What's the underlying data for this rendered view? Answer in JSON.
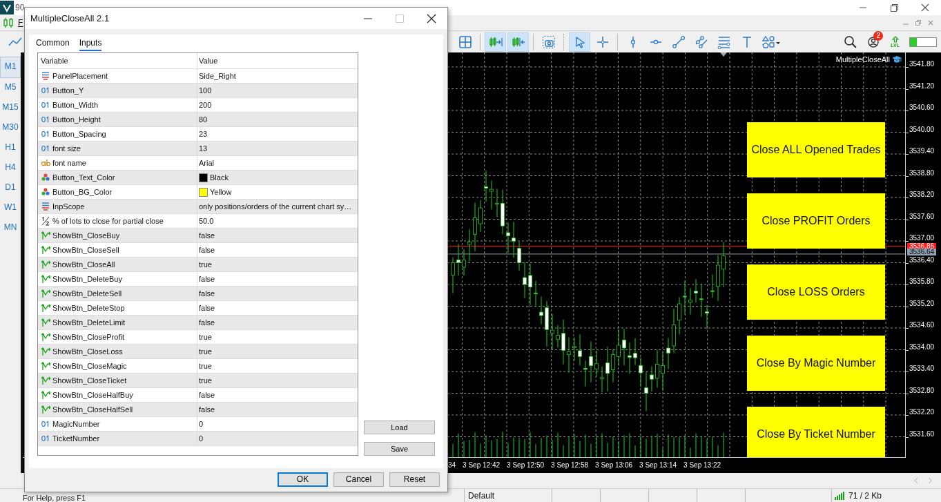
{
  "app": {
    "title": "90",
    "menu": [
      "F"
    ]
  },
  "toolbar": [
    {
      "kind": "grid",
      "on": false
    },
    {
      "kind": "autoscroll",
      "on": true
    },
    {
      "kind": "shift",
      "on": true
    },
    {
      "kind": "screenshot",
      "on": false
    },
    {
      "kind": "cursor",
      "on": true
    },
    {
      "kind": "crosshair",
      "on": false
    },
    {
      "kind": "vline",
      "on": false
    },
    {
      "kind": "hline",
      "on": false
    },
    {
      "kind": "trendline",
      "on": false
    },
    {
      "kind": "channel",
      "on": false
    },
    {
      "kind": "fibo",
      "on": false
    },
    {
      "kind": "text",
      "on": false
    },
    {
      "kind": "shapes",
      "on": false
    }
  ],
  "notifications_badge": "2",
  "lvl_label": "LVL",
  "meter": {
    "level": 0.27
  },
  "timeframes": [
    {
      "label": "M1",
      "selected": true
    },
    {
      "label": "M5",
      "selected": false
    },
    {
      "label": "M15",
      "selected": false
    },
    {
      "label": "M30",
      "selected": false
    },
    {
      "label": "H1",
      "selected": false
    },
    {
      "label": "H4",
      "selected": false
    },
    {
      "label": "D1",
      "selected": false
    },
    {
      "label": "W1",
      "selected": false
    },
    {
      "label": "MN",
      "selected": false
    }
  ],
  "chart": {
    "indicator_label": "MultipleCloseAll",
    "buttons": [
      "Close ALL Opened Trades",
      "Close PROFIT Orders",
      "Close LOSS Orders",
      "Close By Magic Number",
      "Close By Ticket Number"
    ],
    "price_labels": [
      "3541.80",
      "3541.20",
      "3540.60",
      "3540.00",
      "3539.40",
      "3538.80",
      "3538.20",
      "3537.60",
      "3537.00",
      "3536.40",
      "3535.80",
      "3535.20",
      "3534.60",
      "3534.00",
      "3533.40",
      "3532.80",
      "3532.20",
      "3531.60"
    ],
    "price_tags": [
      {
        "text": "3536.86",
        "kind": "ask"
      },
      {
        "text": "3536.64",
        "kind": "bid"
      }
    ],
    "time_labels": [
      "34",
      "3 Sep 12:42",
      "3 Sep 12:50",
      "3 Sep 12:58",
      "3 Sep 13:06",
      "3 Sep 13:14",
      "3 Sep 13:22"
    ]
  },
  "dialog": {
    "title": "MultipleCloseAll 2.1",
    "tabs": [
      {
        "label": "Common",
        "selected": false
      },
      {
        "label": "Inputs",
        "selected": true
      }
    ],
    "columns": [
      "Variable",
      "Value"
    ],
    "rows": [
      {
        "kind": "enum",
        "variable": "PanelPlacement",
        "value": "Side_Right"
      },
      {
        "kind": "int",
        "variable": "Button_Y",
        "value": "100"
      },
      {
        "kind": "int",
        "variable": "Button_Width",
        "value": "200"
      },
      {
        "kind": "int",
        "variable": "Button_Height",
        "value": "80"
      },
      {
        "kind": "int",
        "variable": "Button_Spacing",
        "value": "23"
      },
      {
        "kind": "int",
        "variable": "font size",
        "value": "13"
      },
      {
        "kind": "string",
        "variable": "font name",
        "value": "Arial"
      },
      {
        "kind": "color",
        "variable": "Button_Text_Color",
        "value": "Black",
        "color": "#000000"
      },
      {
        "kind": "color",
        "variable": "Button_BG_Color",
        "value": "Yellow",
        "color": "#ffff00"
      },
      {
        "kind": "enum",
        "variable": "InpScope",
        "value": "only positions/orders of the current chart sy…"
      },
      {
        "kind": "double",
        "variable": "% of lots to close for partial close",
        "value": "50.0"
      },
      {
        "kind": "bool",
        "variable": "ShowBtn_CloseBuy",
        "value": "false"
      },
      {
        "kind": "bool",
        "variable": "ShowBtn_CloseSell",
        "value": "false"
      },
      {
        "kind": "bool",
        "variable": "ShowBtn_CloseAll",
        "value": "true"
      },
      {
        "kind": "bool",
        "variable": "ShowBtn_DeleteBuy",
        "value": "false"
      },
      {
        "kind": "bool",
        "variable": "ShowBtn_DeleteSell",
        "value": "false"
      },
      {
        "kind": "bool",
        "variable": "ShowBtn_DeleteStop",
        "value": "false"
      },
      {
        "kind": "bool",
        "variable": "ShowBtn_DeleteLimit",
        "value": "false"
      },
      {
        "kind": "bool",
        "variable": "ShowBtn_CloseProfit",
        "value": "true"
      },
      {
        "kind": "bool",
        "variable": "ShowBtn_CloseLoss",
        "value": "true"
      },
      {
        "kind": "bool",
        "variable": "ShowBtn_CloseMagic",
        "value": "true"
      },
      {
        "kind": "bool",
        "variable": "ShowBtn_CloseTicket",
        "value": "true"
      },
      {
        "kind": "bool",
        "variable": "ShowBtn_CloseHalfBuy",
        "value": "false"
      },
      {
        "kind": "bool",
        "variable": "ShowBtn_CloseHalfSell",
        "value": "false"
      },
      {
        "kind": "int",
        "variable": "MagicNumber",
        "value": "0"
      },
      {
        "kind": "int",
        "variable": "TicketNumber",
        "value": "0"
      }
    ],
    "side_buttons": [
      "Load",
      "Save"
    ],
    "buttons": [
      {
        "label": "OK",
        "default": true
      },
      {
        "label": "Cancel",
        "default": false
      },
      {
        "label": "Reset",
        "default": false
      }
    ]
  },
  "status_bar": {
    "help": "For Help, press F1",
    "profile": "Default",
    "traffic": "71 / 2 Kb"
  }
}
